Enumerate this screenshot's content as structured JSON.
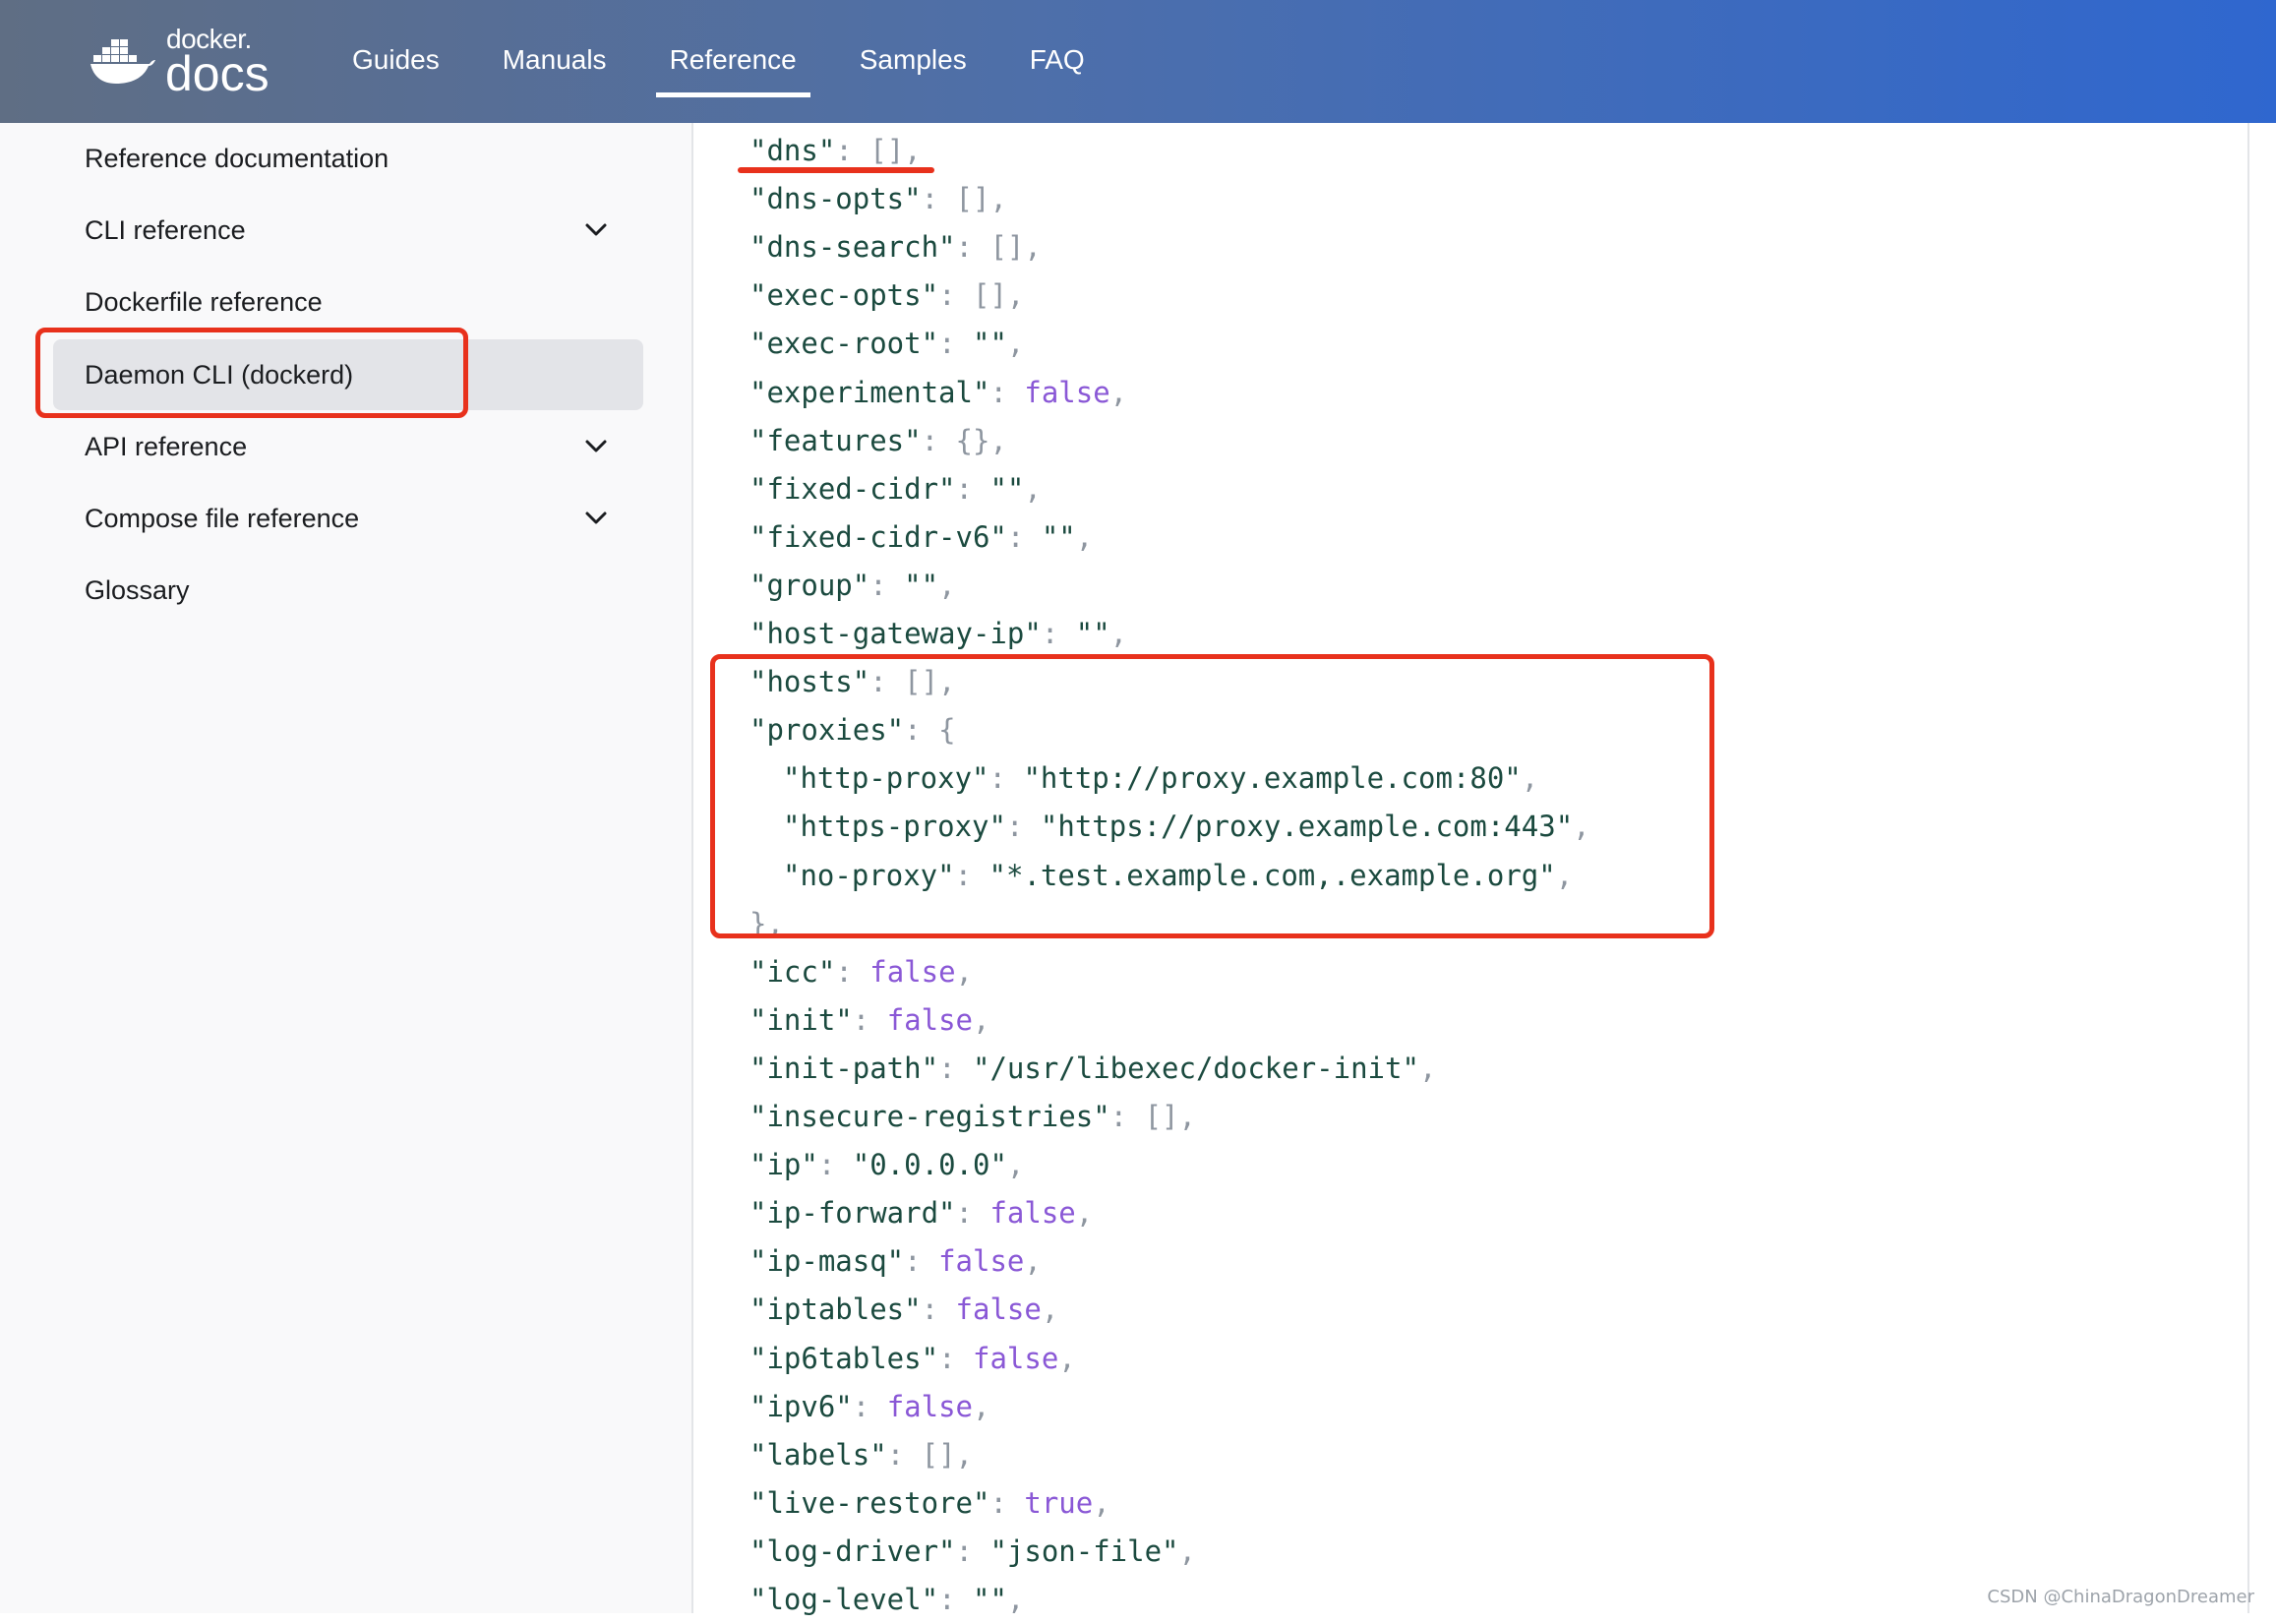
{
  "header": {
    "logo_small": "docker.",
    "logo_big": "docs",
    "nav": [
      {
        "label": "Guides",
        "active": false
      },
      {
        "label": "Manuals",
        "active": false
      },
      {
        "label": "Reference",
        "active": true
      },
      {
        "label": "Samples",
        "active": false
      },
      {
        "label": "FAQ",
        "active": false
      }
    ]
  },
  "sidebar": {
    "items": [
      {
        "label": "Reference documentation",
        "expandable": false,
        "active": false
      },
      {
        "label": "CLI reference",
        "expandable": true,
        "active": false
      },
      {
        "label": "Dockerfile reference",
        "expandable": false,
        "active": false
      },
      {
        "label": "Daemon CLI (dockerd)",
        "expandable": false,
        "active": true
      },
      {
        "label": "API reference",
        "expandable": true,
        "active": false
      },
      {
        "label": "Compose file reference",
        "expandable": true,
        "active": false
      },
      {
        "label": "Glossary",
        "expandable": false,
        "active": false
      }
    ]
  },
  "code_lines": [
    {
      "indent": 0,
      "key": "dns",
      "value": "[],",
      "type": "punct"
    },
    {
      "indent": 0,
      "key": "dns-opts",
      "value": "[],",
      "type": "punct"
    },
    {
      "indent": 0,
      "key": "dns-search",
      "value": "[],",
      "type": "punct"
    },
    {
      "indent": 0,
      "key": "exec-opts",
      "value": "[],",
      "type": "punct"
    },
    {
      "indent": 0,
      "key": "exec-root",
      "value": "\"\",",
      "type": "string"
    },
    {
      "indent": 0,
      "key": "experimental",
      "value": "false",
      "type": "bool"
    },
    {
      "indent": 0,
      "key": "features",
      "value": "{},",
      "type": "punct"
    },
    {
      "indent": 0,
      "key": "fixed-cidr",
      "value": "\"\",",
      "type": "string"
    },
    {
      "indent": 0,
      "key": "fixed-cidr-v6",
      "value": "\"\",",
      "type": "string"
    },
    {
      "indent": 0,
      "key": "group",
      "value": "\"\",",
      "type": "string"
    },
    {
      "indent": 0,
      "key": "host-gateway-ip",
      "value": "\"\",",
      "type": "string"
    },
    {
      "indent": 0,
      "key": "hosts",
      "value": "[],",
      "type": "punct"
    },
    {
      "indent": 0,
      "key": "proxies",
      "value": "{",
      "type": "punct"
    },
    {
      "indent": 1,
      "key": "http-proxy",
      "value": "\"http://proxy.example.com:80\",",
      "type": "string"
    },
    {
      "indent": 1,
      "key": "https-proxy",
      "value": "\"https://proxy.example.com:443\",",
      "type": "string"
    },
    {
      "indent": 1,
      "key": "no-proxy",
      "value": "\"*.test.example.com,.example.org\",",
      "type": "string"
    },
    {
      "indent": 0,
      "key": "",
      "value": "},",
      "type": "punct"
    },
    {
      "indent": 0,
      "key": "icc",
      "value": "false",
      "type": "bool"
    },
    {
      "indent": 0,
      "key": "init",
      "value": "false",
      "type": "bool"
    },
    {
      "indent": 0,
      "key": "init-path",
      "value": "\"/usr/libexec/docker-init\",",
      "type": "string"
    },
    {
      "indent": 0,
      "key": "insecure-registries",
      "value": "[],",
      "type": "punct"
    },
    {
      "indent": 0,
      "key": "ip",
      "value": "\"0.0.0.0\",",
      "type": "string"
    },
    {
      "indent": 0,
      "key": "ip-forward",
      "value": "false",
      "type": "bool"
    },
    {
      "indent": 0,
      "key": "ip-masq",
      "value": "false",
      "type": "bool"
    },
    {
      "indent": 0,
      "key": "iptables",
      "value": "false",
      "type": "bool"
    },
    {
      "indent": 0,
      "key": "ip6tables",
      "value": "false",
      "type": "bool"
    },
    {
      "indent": 0,
      "key": "ipv6",
      "value": "false",
      "type": "bool"
    },
    {
      "indent": 0,
      "key": "labels",
      "value": "[],",
      "type": "punct"
    },
    {
      "indent": 0,
      "key": "live-restore",
      "value": "true",
      "type": "bool"
    },
    {
      "indent": 0,
      "key": "log-driver",
      "value": "\"json-file\",",
      "type": "string"
    },
    {
      "indent": 0,
      "key": "log-level",
      "value": "\"\",",
      "type": "string"
    }
  ],
  "watermark": "CSDN @ChinaDragonDreamer",
  "colors": {
    "accent_annotation": "#e8311c",
    "header_gradient_start": "#5f6e84",
    "header_gradient_end": "#2f67cf",
    "code_key": "#1b4a3f",
    "code_bool": "#8a58d6",
    "code_punct": "#8e96a0"
  }
}
